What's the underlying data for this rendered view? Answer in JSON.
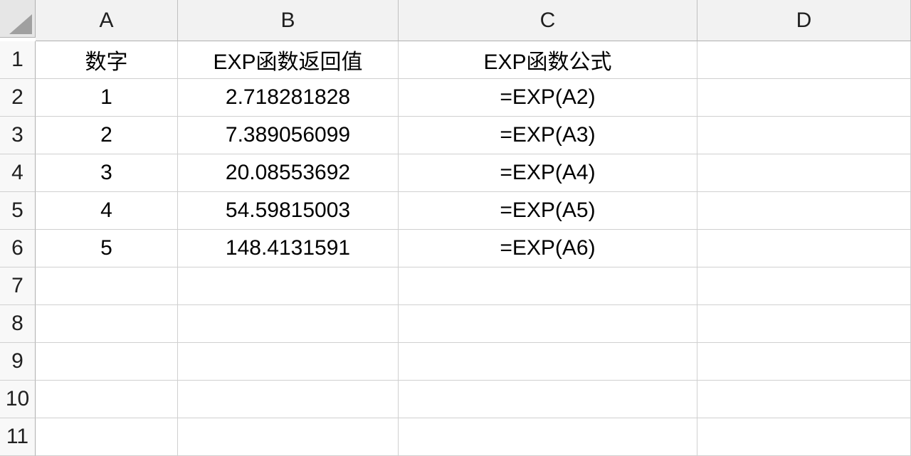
{
  "columns": [
    "A",
    "B",
    "C",
    "D"
  ],
  "rows": [
    "1",
    "2",
    "3",
    "4",
    "5",
    "6",
    "7",
    "8",
    "9",
    "10",
    "11"
  ],
  "headers": {
    "A": "数字",
    "B": "EXP函数返回值",
    "C": "EXP函数公式"
  },
  "dataRows": [
    {
      "A": "1",
      "B": "2.718281828",
      "C": "=EXP(A2)"
    },
    {
      "A": "2",
      "B": "7.389056099",
      "C": "=EXP(A3)"
    },
    {
      "A": "3",
      "B": "20.08553692",
      "C": "=EXP(A4)"
    },
    {
      "A": "4",
      "B": "54.59815003",
      "C": "=EXP(A5)"
    },
    {
      "A": "5",
      "B": "148.4131591",
      "C": "=EXP(A6)"
    }
  ]
}
